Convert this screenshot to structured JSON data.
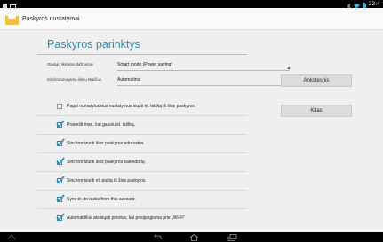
{
  "status_bar": {
    "time": "22:4"
  },
  "action_bar": {
    "title": "Paskyros nustatymai"
  },
  "page": {
    "title": "Paskyros parinktys"
  },
  "settings": [
    {
      "label": "Gautųjų tikrinimo dažnumas",
      "value": "Smart mode (Power saving)"
    },
    {
      "label": "Sinchronizuojamų dienų skaičius",
      "value": "Automatinis"
    }
  ],
  "checkboxes": [
    {
      "label": "Pagal numatytuosius nustatymus siųsti el. laišką iš šios paskyros.",
      "checked": false
    },
    {
      "label": "Pranešti man, kai gausiu el. laišką.",
      "checked": true
    },
    {
      "label": "Sinchronizuoti šios paskyros adresatus.",
      "checked": true
    },
    {
      "label": "Sinchronizuoti šios paskyros kalendorių.",
      "checked": true
    },
    {
      "label": "Sinchronizuoti el. paštą iš šios paskyros.",
      "checked": true
    },
    {
      "label": "Sync to-do tasks from this account.",
      "checked": true
    },
    {
      "label": "Automatiškai atsisiųsti priedus, kai prisijungiama prie „Wi-Fi\"",
      "checked": true
    }
  ],
  "buttons": {
    "previous": "Ankstesnis",
    "next": "Kitas"
  },
  "colors": {
    "accent": "#2d8fb0",
    "background": "#efefef",
    "bar": "#000000"
  }
}
